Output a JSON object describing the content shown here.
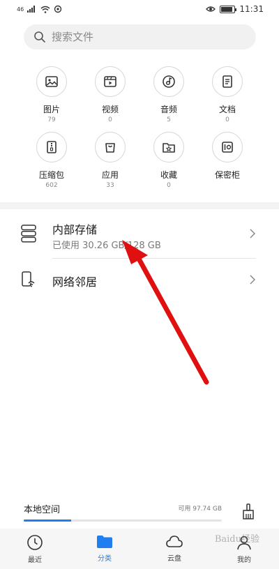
{
  "status_bar": {
    "signal_text": "46",
    "time": "11:31"
  },
  "search": {
    "placeholder": "搜索文件"
  },
  "categories": [
    {
      "label": "图片",
      "count": "79",
      "icon": "image-icon"
    },
    {
      "label": "视频",
      "count": "0",
      "icon": "video-icon"
    },
    {
      "label": "音频",
      "count": "5",
      "icon": "audio-icon"
    },
    {
      "label": "文档",
      "count": "0",
      "icon": "document-icon"
    },
    {
      "label": "压缩包",
      "count": "602",
      "icon": "archive-icon"
    },
    {
      "label": "应用",
      "count": "33",
      "icon": "app-bag-icon"
    },
    {
      "label": "收藏",
      "count": "0",
      "icon": "star-folder-icon"
    },
    {
      "label": "保密柜",
      "count": "",
      "icon": "safe-icon"
    }
  ],
  "locations": {
    "internal": {
      "title": "内部存储",
      "subtitle": "已使用 30.26 GB/128 GB"
    },
    "network": {
      "title": "网络邻居"
    }
  },
  "storage": {
    "title": "本地空间",
    "free": "可用 97.74 GB",
    "used_fraction": 0.24
  },
  "nav": [
    {
      "label": "最近",
      "icon": "clock-icon"
    },
    {
      "label": "分类",
      "icon": "folder-icon",
      "active": true
    },
    {
      "label": "云盘",
      "icon": "cloud-icon"
    },
    {
      "label": "我的",
      "icon": "person-icon"
    }
  ],
  "watermark": "Baidu经验",
  "colors": {
    "accent": "#1f7ef0",
    "annotation_arrow": "#e01010"
  }
}
